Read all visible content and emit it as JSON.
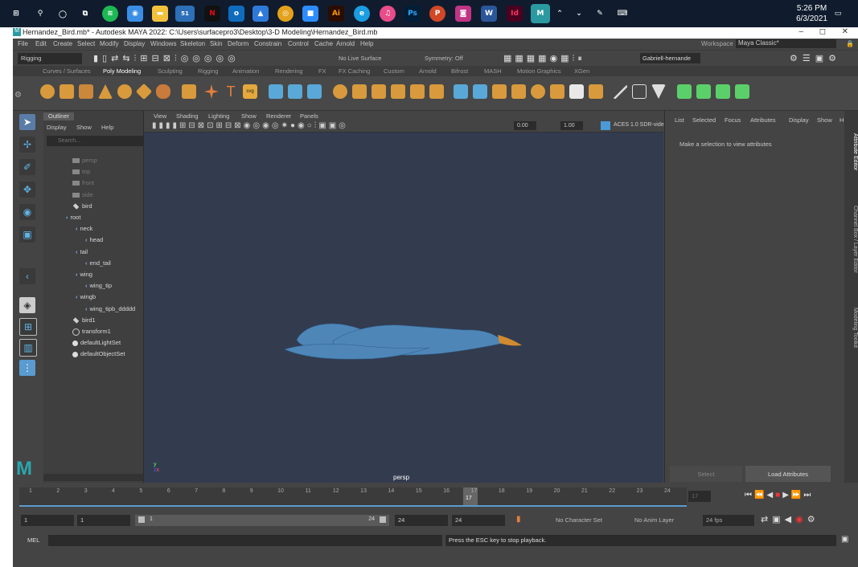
{
  "taskbar": {
    "time": "5:26 PM",
    "date": "6/3/2021",
    "mail_badge": "51",
    "icons": [
      "windows-icon",
      "search-icon",
      "cortana-icon",
      "task-view-icon",
      "spotify-icon",
      "app-icon",
      "file-explorer-icon",
      "mail-icon",
      "netflix-icon",
      "outlook-icon",
      "photos-icon",
      "chrome-icon",
      "zoom-icon",
      "illustrator-icon",
      "edge-icon",
      "itunes-icon",
      "photoshop-icon",
      "powerpoint-icon",
      "instagram-icon",
      "word-icon",
      "indesign-icon",
      "maya-icon"
    ]
  },
  "window": {
    "title": "Hernandez_Bird.mb* - Autodesk MAYA 2022: C:\\Users\\surfacepro3\\Desktop\\3-D Modeling\\Hernandez_Bird.mb",
    "minimize": "–",
    "maximize": "◻",
    "close": "✕"
  },
  "menubar": [
    "File",
    "Edit",
    "Create",
    "Select",
    "Modify",
    "Display",
    "Windows",
    "Skeleton",
    "Skin",
    "Deform",
    "Constrain",
    "Control",
    "Cache",
    "Arnold",
    "Help"
  ],
  "workspace": {
    "label": "Workspace :",
    "value": "Maya Classic*"
  },
  "statusline": {
    "mode": "Rigging",
    "live_surface": "No Live Surface",
    "symmetry": "Symmetry: Off",
    "user": "Gabriell-hernande"
  },
  "shelf_tabs": [
    "Curves / Surfaces",
    "Poly Modeling",
    "Sculpting",
    "Rigging",
    "Animation",
    "Rendering",
    "FX",
    "FX Caching",
    "Custom",
    "Arnold",
    "Bifrost",
    "MASH",
    "Motion Graphics",
    "XGen"
  ],
  "shelf_active": "Poly Modeling",
  "outliner": {
    "tab": "Outliner",
    "menus": [
      "Display",
      "Show",
      "Help"
    ],
    "search_placeholder": "Search...",
    "items": [
      {
        "label": "persp",
        "kind": "camera",
        "indent": 0,
        "dim": true
      },
      {
        "label": "top",
        "kind": "camera",
        "indent": 0,
        "dim": true
      },
      {
        "label": "front",
        "kind": "camera",
        "indent": 0,
        "dim": true
      },
      {
        "label": "side",
        "kind": "camera",
        "indent": 0,
        "dim": true
      },
      {
        "label": "bird",
        "kind": "mesh",
        "indent": 0,
        "dim": false
      },
      {
        "label": "root",
        "kind": "joint",
        "indent": 0,
        "dim": false
      },
      {
        "label": "neck",
        "kind": "joint",
        "indent": 1,
        "dim": false
      },
      {
        "label": "head",
        "kind": "joint",
        "indent": 2,
        "dim": false
      },
      {
        "label": "tail",
        "kind": "joint",
        "indent": 1,
        "dim": false
      },
      {
        "label": "end_tail",
        "kind": "joint",
        "indent": 2,
        "dim": false
      },
      {
        "label": "wing",
        "kind": "joint",
        "indent": 1,
        "dim": false
      },
      {
        "label": "wing_tip",
        "kind": "joint",
        "indent": 2,
        "dim": false
      },
      {
        "label": "wingb",
        "kind": "joint",
        "indent": 1,
        "dim": false
      },
      {
        "label": "wing_tipb_ddddd",
        "kind": "joint",
        "indent": 2,
        "dim": false
      },
      {
        "label": "bird1",
        "kind": "mesh",
        "indent": 0,
        "dim": false
      },
      {
        "label": "transform1",
        "kind": "transform",
        "indent": 0,
        "dim": false
      },
      {
        "label": "defaultLightSet",
        "kind": "set",
        "indent": 0,
        "dim": false
      },
      {
        "label": "defaultObjectSet",
        "kind": "set",
        "indent": 0,
        "dim": false
      }
    ]
  },
  "viewport": {
    "menus": [
      "View",
      "Shading",
      "Lighting",
      "Show",
      "Renderer",
      "Panels"
    ],
    "camera": "persp",
    "exposure": "0.00",
    "gamma": "1.00",
    "color_space": "ACES 1.0 SDR-video (",
    "bird_color": "#4e86b8",
    "beak_color": "#d08a30",
    "bg_color": "#333b4f"
  },
  "attribute_editor": {
    "menus": [
      "List",
      "Selected",
      "Focus",
      "Attributes",
      "Display",
      "Show",
      "H"
    ],
    "message": "Make a selection to view attributes",
    "select_button": "Select",
    "load_button": "Load Attributes"
  },
  "side_tabs": [
    "Attribute Editor",
    "Channel Box / Layer Editor",
    "Modeling Toolkit"
  ],
  "timeslider": {
    "ticks": [
      "1",
      "2",
      "3",
      "4",
      "5",
      "6",
      "7",
      "8",
      "9",
      "10",
      "11",
      "12",
      "13",
      "14",
      "15",
      "16",
      "17",
      "18",
      "19",
      "20",
      "21",
      "22",
      "23",
      "24"
    ],
    "current_frame": "17",
    "current_frame_box": "17"
  },
  "range": {
    "start": "1",
    "start_inner": "1",
    "range_start": "1",
    "range_end": "24",
    "end_inner": "24",
    "end": "24",
    "character_set": "No Character Set",
    "anim_layer": "No Anim Layer",
    "fps": "24 fps"
  },
  "commandline": {
    "label": "MEL",
    "status": "Press the ESC key to stop playback."
  }
}
